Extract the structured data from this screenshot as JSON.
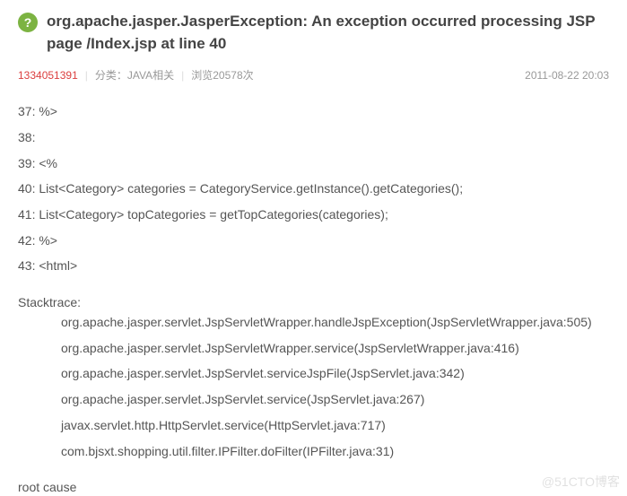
{
  "header": {
    "icon_text": "?",
    "title": "org.apache.jasper.JasperException: An exception occurred processing JSP page /Index.jsp at line 40"
  },
  "meta": {
    "author": "1334051391",
    "category_label": "分类：",
    "category_value": "JAVA相关",
    "views": "浏览20578次",
    "date": "2011-08-22 20:03"
  },
  "code_lines": [
    "37:  %>",
    "38:",
    "39: <%",
    "40: List<Category> categories = CategoryService.getInstance().getCategories();",
    "41: List<Category> topCategories = getTopCategories(categories);",
    "42:  %>",
    "43: <html>"
  ],
  "stacktrace": {
    "label": "Stacktrace:",
    "lines": [
      "org.apache.jasper.servlet.JspServletWrapper.handleJspException(JspServletWrapper.java:505)",
      "org.apache.jasper.servlet.JspServletWrapper.service(JspServletWrapper.java:416)",
      "org.apache.jasper.servlet.JspServlet.serviceJspFile(JspServlet.java:342)",
      "org.apache.jasper.servlet.JspServlet.service(JspServlet.java:267)",
      "javax.servlet.http.HttpServlet.service(HttpServlet.java:717)",
      "com.bjsxt.shopping.util.filter.IPFilter.doFilter(IPFilter.java:31)"
    ]
  },
  "root_cause": "root cause",
  "watermark": "@51CTO博客"
}
